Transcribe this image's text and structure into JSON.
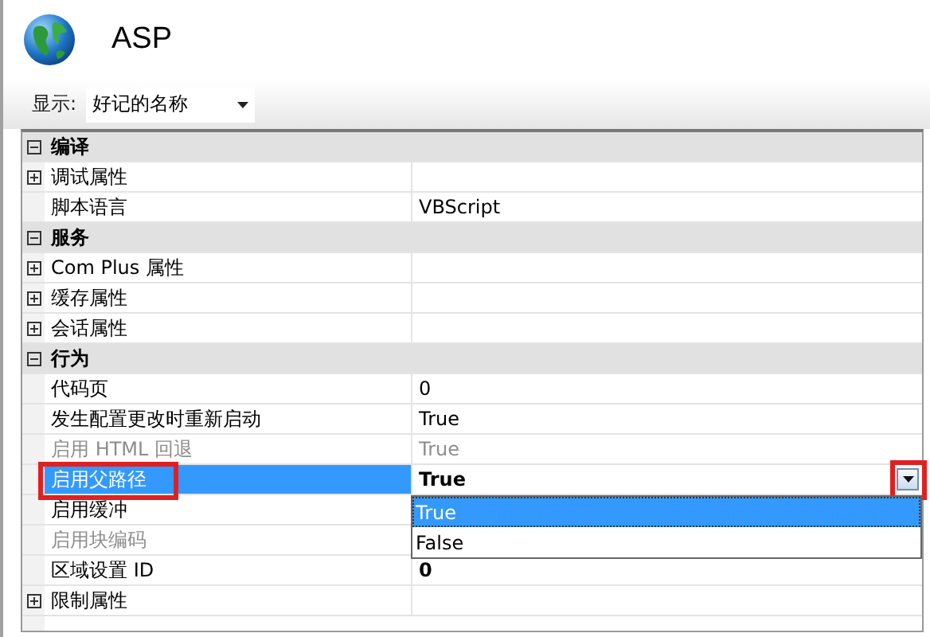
{
  "window": {
    "title": "ASP"
  },
  "toolbar": {
    "label": "显示:",
    "dropdown": {
      "value": "好记的名称"
    }
  },
  "property_grid": {
    "sections": [
      {
        "name": "编译",
        "expanded": true,
        "items": [
          {
            "kind": "group",
            "name": "调试属性",
            "expanded": false,
            "selected": false
          },
          {
            "kind": "property",
            "name": "脚本语言",
            "value": "VBScript",
            "disabled": false,
            "modified": false,
            "selected": false,
            "highlighted": false
          }
        ]
      },
      {
        "name": "服务",
        "expanded": true,
        "items": [
          {
            "kind": "group",
            "name": "Com Plus 属性",
            "expanded": false,
            "selected": false
          },
          {
            "kind": "group",
            "name": "缓存属性",
            "expanded": false,
            "selected": false
          },
          {
            "kind": "group",
            "name": "会话属性",
            "expanded": false,
            "selected": false
          }
        ]
      },
      {
        "name": "行为",
        "expanded": true,
        "items": [
          {
            "kind": "property",
            "name": "代码页",
            "value": "0",
            "disabled": false,
            "modified": false,
            "selected": false,
            "highlighted": false
          },
          {
            "kind": "property",
            "name": "发生配置更改时重新启动",
            "value": "True",
            "disabled": false,
            "modified": false,
            "selected": false,
            "highlighted": false
          },
          {
            "kind": "property",
            "name": "启用 HTML 回退",
            "value": "True",
            "disabled": true,
            "modified": false,
            "selected": false,
            "highlighted": false
          },
          {
            "kind": "property",
            "name": "启用父路径",
            "value": "True",
            "disabled": false,
            "modified": true,
            "selected": true,
            "highlighted": true,
            "editor": {
              "open": true,
              "button_highlighted": true,
              "options": [
                {
                  "label": "True",
                  "selected": true
                },
                {
                  "label": "False",
                  "selected": false
                }
              ]
            }
          },
          {
            "kind": "property",
            "name": "启用缓冲",
            "disabled": false,
            "selected": false,
            "highlighted": false
          },
          {
            "kind": "property",
            "name": "启用块编码",
            "disabled": true,
            "selected": false,
            "highlighted": false
          },
          {
            "kind": "property",
            "name": "区域设置 ID",
            "value": "0",
            "disabled": false,
            "modified": true,
            "selected": false,
            "highlighted": false
          },
          {
            "kind": "group",
            "name": "限制属性",
            "expanded": false,
            "selected": false
          }
        ]
      }
    ]
  }
}
